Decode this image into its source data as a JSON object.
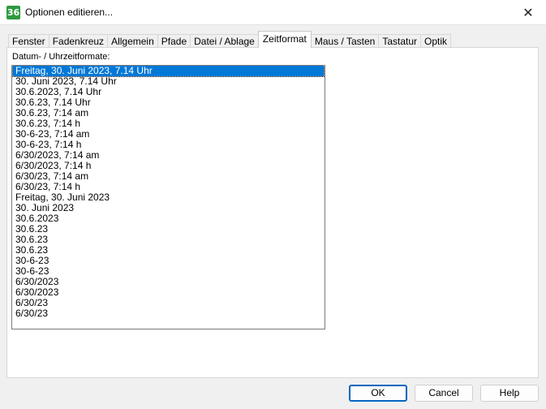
{
  "window": {
    "title": "Optionen editieren...",
    "icon_text": "36",
    "close_glyph": "✕"
  },
  "tabs": [
    {
      "label": "Fenster"
    },
    {
      "label": "Fadenkreuz"
    },
    {
      "label": "Allgemein"
    },
    {
      "label": "Pfade"
    },
    {
      "label": "Datei / Ablage"
    },
    {
      "label": "Zeitformat",
      "active": true
    },
    {
      "label": "Maus / Tasten"
    },
    {
      "label": "Tastatur"
    },
    {
      "label": "Optik"
    }
  ],
  "panel": {
    "list_label": "Datum- / Uhrzeitformate:",
    "selected_index": 0,
    "formats": [
      "Freitag, 30. Juni 2023, 7.14 Uhr",
      "30. Juni 2023, 7.14 Uhr",
      "30.6.2023, 7.14 Uhr",
      "30.6.23, 7.14 Uhr",
      "30.6.23, 7:14 am",
      "30.6.23, 7:14 h",
      "30-6-23, 7:14 am",
      "30-6-23, 7:14 h",
      "6/30/2023, 7:14 am",
      "6/30/2023, 7:14 h",
      "6/30/23, 7:14 am",
      "6/30/23, 7:14 h",
      "Freitag, 30. Juni 2023",
      "30. Juni 2023",
      "30.6.2023",
      "30.6.23",
      "30.6.23",
      "30.6.23",
      "30-6-23",
      "30-6-23",
      "6/30/2023",
      "6/30/2023",
      "6/30/23",
      "6/30/23"
    ]
  },
  "buttons": {
    "ok": "OK",
    "cancel": "Cancel",
    "help": "Help"
  }
}
